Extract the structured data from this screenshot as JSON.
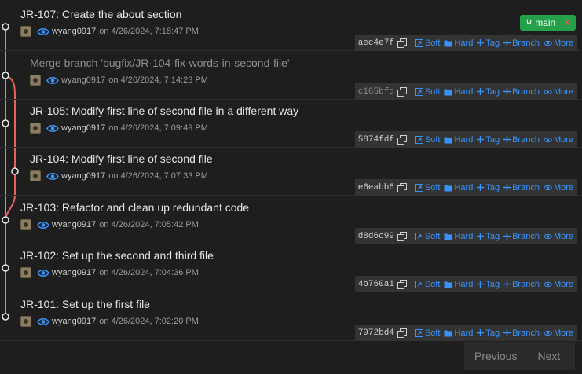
{
  "branch": {
    "name": "main",
    "icon": "git-branch-icon",
    "color": "#24a148"
  },
  "actions": {
    "soft": "Soft",
    "hard": "Hard",
    "tag": "Tag",
    "branch": "Branch",
    "more": "More"
  },
  "commits": [
    {
      "title": "JR-107: Create the about section",
      "author": "wyang0917",
      "date": "on 4/26/2024, 7:18:47 PM",
      "sha": "aec4e7f"
    },
    {
      "title": "Merge branch 'bugfix/JR-104-fix-words-in-second-file'",
      "author": "wyang0917",
      "date": "on 4/26/2024, 7:14:23 PM",
      "sha": "c165bfd"
    },
    {
      "title": "JR-105: Modify first line of second file in a different way",
      "author": "wyang0917",
      "date": "on 4/26/2024, 7:09:49 PM",
      "sha": "5874fdf"
    },
    {
      "title": "JR-104: Modify first line of second file",
      "author": "wyang0917",
      "date": "on 4/26/2024, 7:07:33 PM",
      "sha": "e6eabb6"
    },
    {
      "title": "JR-103: Refactor and clean up redundant code",
      "author": "wyang0917",
      "date": "on 4/26/2024, 7:05:42 PM",
      "sha": "d8d6c99"
    },
    {
      "title": "JR-102: Set up the second and third file",
      "author": "wyang0917",
      "date": "on 4/26/2024, 7:04:36 PM",
      "sha": "4b760a1"
    },
    {
      "title": "JR-101: Set up the first file",
      "author": "wyang0917",
      "date": "on 4/26/2024, 7:02:20 PM",
      "sha": "7972bd4"
    }
  ],
  "pagination": {
    "previous": "Previous",
    "next": "Next"
  },
  "colors": {
    "main_line": "#f0941e",
    "side_line": "#e5645a",
    "link": "#3794ff",
    "background": "#1e1e1e"
  }
}
